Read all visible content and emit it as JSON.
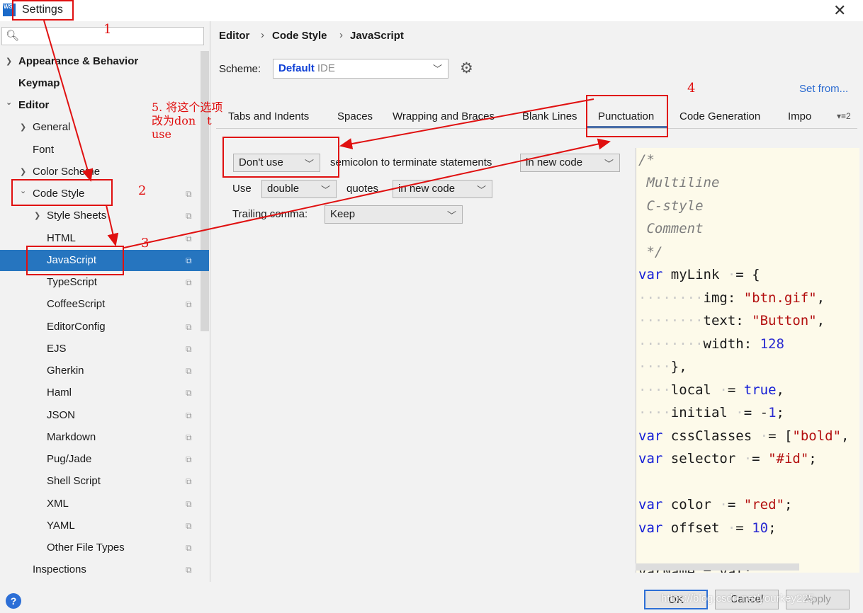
{
  "window": {
    "title": "Settings",
    "logo_line1": "WS",
    "logo_line2": "",
    "close": "✕"
  },
  "search": {
    "icon": "🔍︎"
  },
  "sidebar": {
    "items": [
      {
        "label": "Appearance & Behavior",
        "arrow": "❯"
      },
      {
        "label": "Keymap"
      },
      {
        "label": "Editor",
        "arrow": "⌄"
      },
      {
        "label": "General",
        "arrow": "❯"
      },
      {
        "label": "Font"
      },
      {
        "label": "Color Scheme",
        "arrow": "❯"
      },
      {
        "label": "Code Style",
        "arrow": "⌄"
      },
      {
        "label": "Style Sheets",
        "arrow": "❯"
      },
      {
        "label": "HTML"
      },
      {
        "label": "JavaScript"
      },
      {
        "label": "TypeScript"
      },
      {
        "label": "CoffeeScript"
      },
      {
        "label": "EditorConfig"
      },
      {
        "label": "EJS"
      },
      {
        "label": "Gherkin"
      },
      {
        "label": "Haml"
      },
      {
        "label": "JSON"
      },
      {
        "label": "Markdown"
      },
      {
        "label": "Pug/Jade"
      },
      {
        "label": "Shell Script"
      },
      {
        "label": "XML"
      },
      {
        "label": "YAML"
      },
      {
        "label": "Other File Types"
      },
      {
        "label": "Inspections"
      }
    ],
    "copy_icon": "⧉"
  },
  "breadcrumb": {
    "items": [
      "Editor",
      "Code Style",
      "JavaScript"
    ],
    "sep": "›"
  },
  "scheme": {
    "label": "Scheme:",
    "value": "Default",
    "suffix": "IDE",
    "gear": "⚙",
    "set_from": "Set from..."
  },
  "tabs": {
    "items": [
      "Tabs and Indents",
      "Spaces",
      "Wrapping and Braces",
      "Blank Lines",
      "Punctuation",
      "Code Generation",
      "Impo"
    ],
    "active": "Punctuation",
    "overflow": "▾≡2"
  },
  "punctuation": {
    "semicolon_select": "Don't use",
    "semicolon_text": "semicolon to terminate statements",
    "semicolon_scope": "in new code",
    "use_label": "Use",
    "quotes_select": "double",
    "quotes_text": "quotes",
    "quotes_scope": "in new code",
    "trailing_label": "Trailing comma:",
    "trailing_select": "Keep"
  },
  "preview": {
    "lines": [
      "/*",
      " Multiline",
      " C-style",
      " Comment",
      " */",
      "var myLink = {",
      "        img: \"btn.gif\",",
      "        text: \"Button\",",
      "        width: 128",
      "    },",
      "    local = true,",
      "    initial = -1;",
      "var cssClasses = [\"bold\", \"red\",];",
      "var selector = \"#id\";",
      "",
      "var color = \"red\";",
      "var offset = 10;",
      "",
      "varName = val;"
    ]
  },
  "footer": {
    "help": "?",
    "ok": "OK",
    "cancel": "Cancel",
    "apply": "Apply"
  },
  "watermark": "https://blog.csdn.net/yourkey225",
  "annotations": {
    "n1": "1",
    "n2": "2",
    "n3": "3",
    "n4": "4",
    "text_line1": "5. 将这个选项",
    "text_line2": "改为don　t",
    "text_line3": "use"
  },
  "colors": {
    "selection": "#2675bf",
    "annotation": "#e01010",
    "keyword": "#111bd6",
    "string": "#b30f0f",
    "preview_bg": "#fdfaea"
  }
}
